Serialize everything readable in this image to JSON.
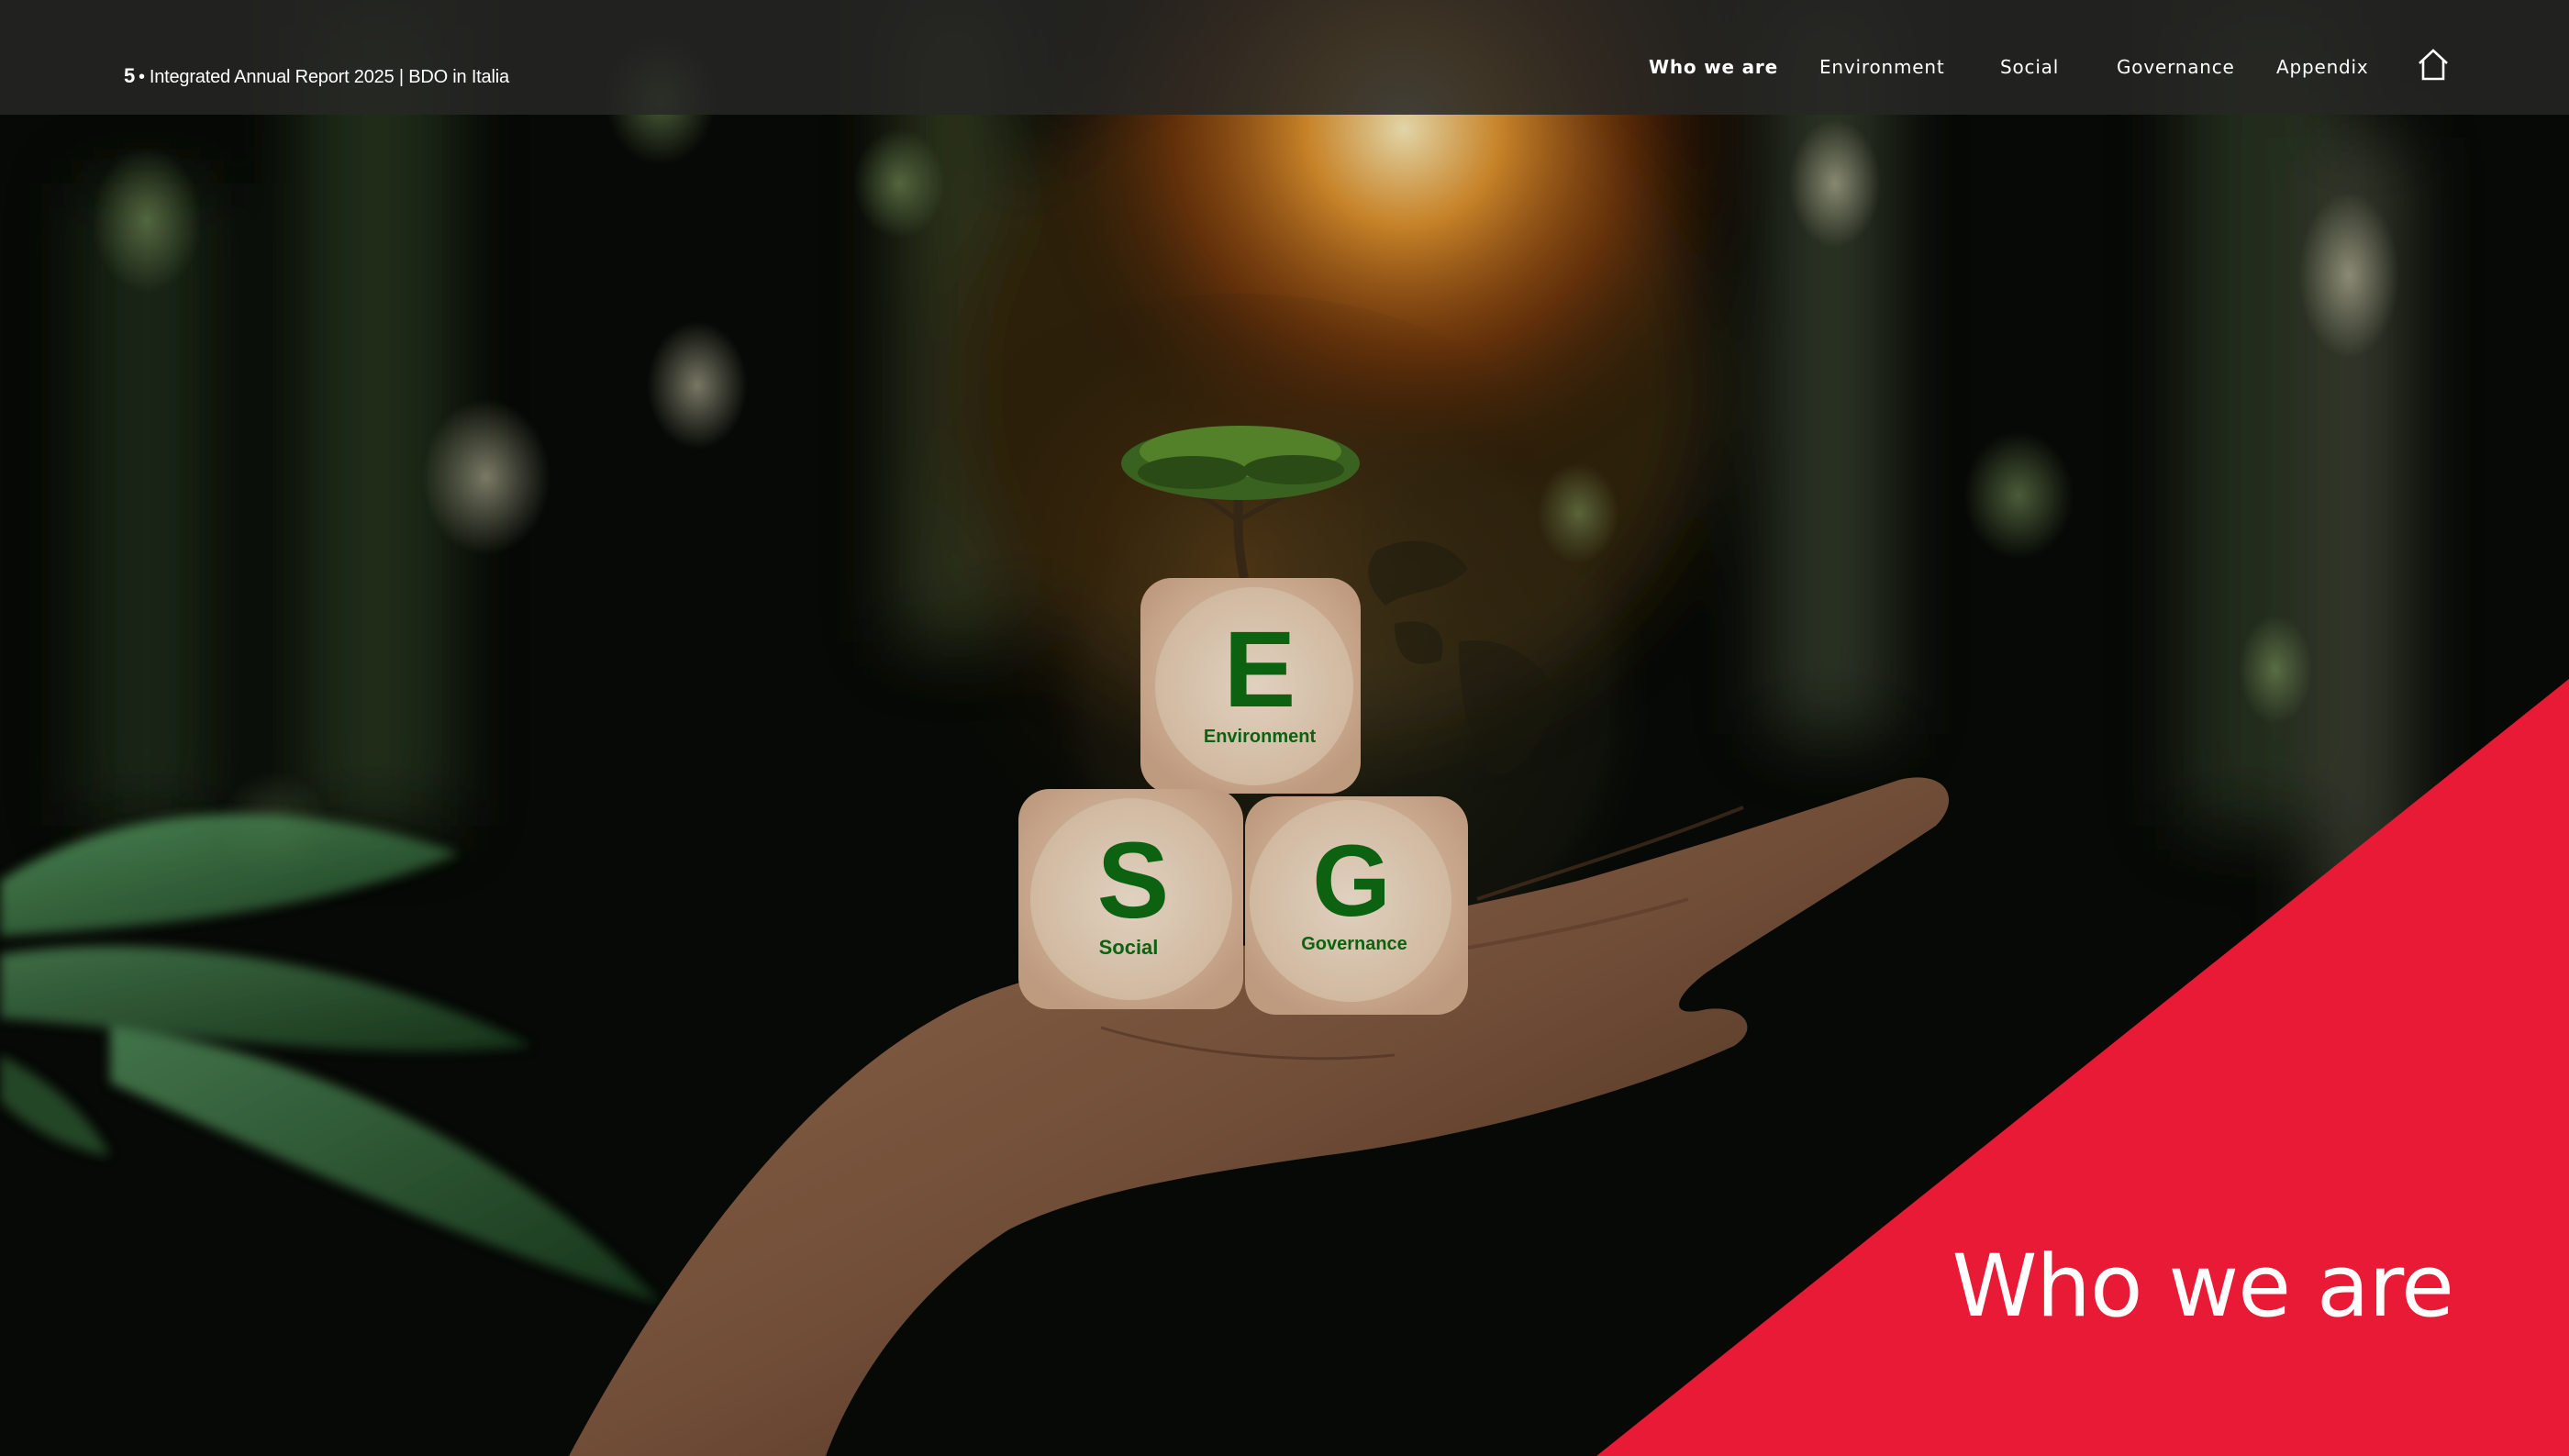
{
  "header": {
    "page_number": "5",
    "separator": "•",
    "report_title": "Integrated Annual Report 2025 | BDO in Italia"
  },
  "nav": {
    "items": [
      {
        "label": "Who we are",
        "active": true
      },
      {
        "label": "Environment",
        "active": false
      },
      {
        "label": "Social",
        "active": false
      },
      {
        "label": "Governance",
        "active": false
      },
      {
        "label": "Appendix",
        "active": false
      }
    ],
    "home_icon": "home-icon"
  },
  "hero": {
    "cubes": [
      {
        "letter": "E",
        "caption": "Environment"
      },
      {
        "letter": "S",
        "caption": "Social"
      },
      {
        "letter": "G",
        "caption": "Governance"
      }
    ]
  },
  "section": {
    "title": "Who we are"
  },
  "colors": {
    "accent_red": "#E81A36",
    "topbar": "#262624",
    "cube_letter_green": "#0E6B12"
  }
}
